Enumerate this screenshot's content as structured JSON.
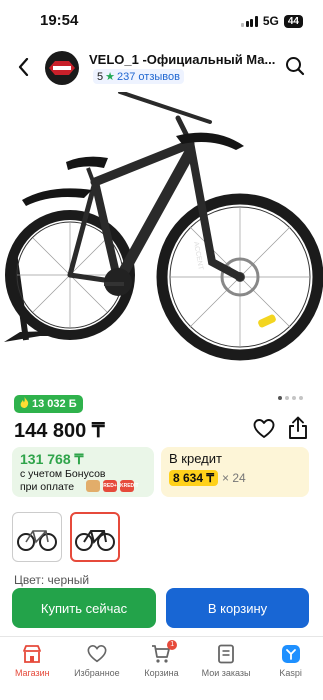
{
  "status": {
    "time": "19:54",
    "network": "5G",
    "battery": "44"
  },
  "header": {
    "shop_name": "VELO_1 -Официальный Ма...",
    "rating": "5",
    "reviews": "237 отзывов"
  },
  "product": {
    "bonus": "13 032 Б",
    "price": "144 800 ₸",
    "bonus_card": {
      "amount": "131 768 ₸",
      "line1": "с учетом Бонусов",
      "line2": "при оплате",
      "pay_icons": [
        "RED+",
        "KREDIT"
      ]
    },
    "credit_card": {
      "title": "В кредит",
      "monthly": "8 634 ₸",
      "term": "× 24"
    },
    "color_label": "Цвет: черный"
  },
  "actions": {
    "buy": "Купить сейчас",
    "cart": "В корзину"
  },
  "tabs": [
    {
      "label": "Магазин",
      "icon": "store-icon",
      "active": true
    },
    {
      "label": "Избранное",
      "icon": "favorites-icon"
    },
    {
      "label": "Корзина",
      "icon": "cart-icon",
      "badge": "1"
    },
    {
      "label": "Мои заказы",
      "icon": "orders-icon"
    },
    {
      "label": "Kaspi",
      "icon": "kaspi-logo-icon"
    }
  ],
  "colors": {
    "green": "#23a34a",
    "blue": "#1866d4",
    "red": "#e64a3b",
    "bonus_badge": "#2fb24c"
  }
}
